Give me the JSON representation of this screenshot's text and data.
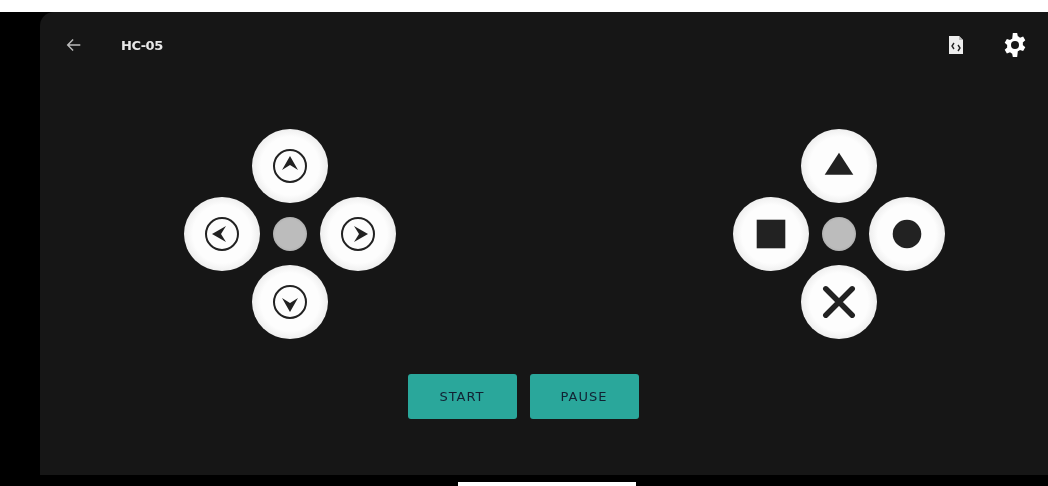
{
  "header": {
    "title": "HC-05"
  },
  "pads": [
    {
      "kind": "arrows"
    },
    {
      "kind": "shapes"
    }
  ],
  "buttons": [
    {
      "label": "START"
    },
    {
      "label": "PAUSE"
    }
  ]
}
